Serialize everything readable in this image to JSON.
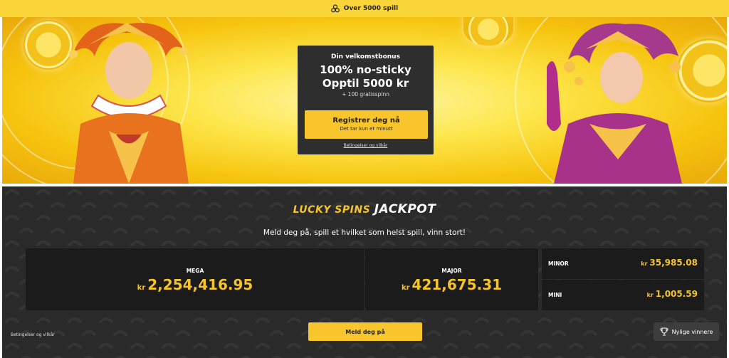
{
  "topbar": {
    "text": "Over 5000 spill",
    "icon": "chips-icon"
  },
  "hero": {
    "promo": {
      "title": "Din velkomstbonus",
      "headline_1": "100% no-sticky",
      "headline_2": "Opptil 5000 kr",
      "extra": "+ 100 gratisspinn",
      "cta_label": "Registrer deg nå",
      "cta_sublabel": "Det tar kun et minutt",
      "terms": "Betingelser og vilkår"
    }
  },
  "jackpot": {
    "logo_part_1": "LUCKY SPINS",
    "logo_part_2": "JACKPOT",
    "subtitle": "Meld deg på, spill et hvilket som helst spill, vinn stort!",
    "currency": "kr",
    "mega": {
      "label": "MEGA",
      "value": "2,254,416.95"
    },
    "major": {
      "label": "MAJOR",
      "value": "421,675.31"
    },
    "minor": {
      "label": "MINOR",
      "value": "35,985.08"
    },
    "mini": {
      "label": "MINI",
      "value": "1,005.59"
    },
    "terms": "Betingelser og vilkår",
    "signup_label": "Meld deg på",
    "winners_label": "Nylige vinnere",
    "winners_icon": "trophy-icon"
  },
  "colors": {
    "accent": "#f8c62c",
    "dark_panel": "#2e2e2e",
    "section_bg": "#2a2a2a",
    "tile_bg": "#1b1b1b"
  }
}
